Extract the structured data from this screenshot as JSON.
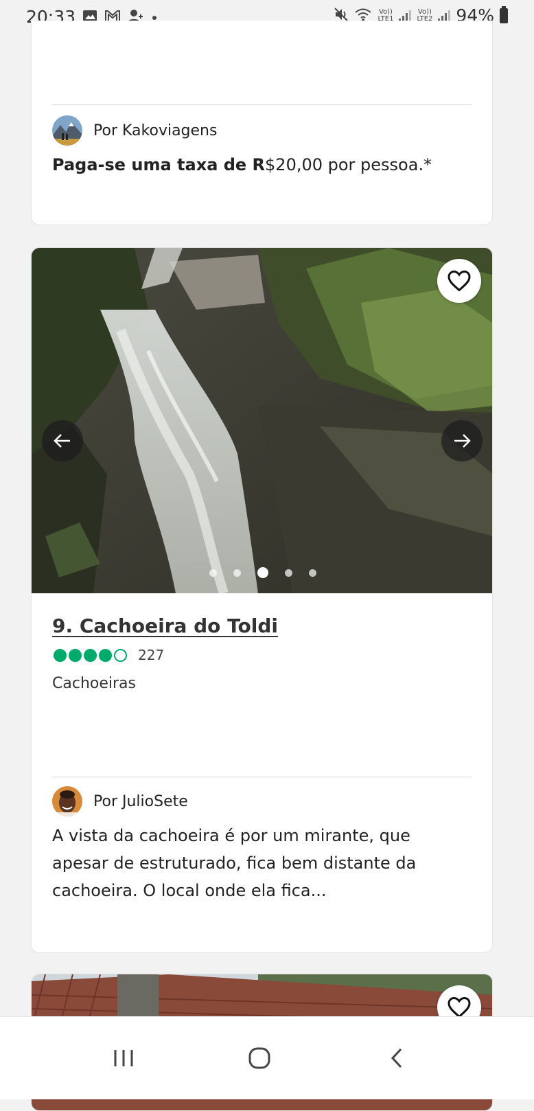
{
  "status_bar": {
    "time": "20:33",
    "battery": "94%",
    "left_icons": [
      "image-icon",
      "gmail-icon",
      "contacts-icon",
      "dot-icon"
    ],
    "right_icons": [
      "mute-icon",
      "wifi-icon",
      "volte-lte1-icon",
      "signal-icon",
      "volte-lte2-icon",
      "signal-icon",
      "battery-icon"
    ],
    "lte1_top": "Vo))",
    "lte1_bottom": "LTE1",
    "lte2_top": "Vo))",
    "lte2_bottom": "LTE2"
  },
  "previous_card": {
    "review": {
      "by_prefix": "Por",
      "author": "Kakoviagens",
      "text_bold": "Paga-se uma taxa de R",
      "text_regular": "$20,00 por pessoa.*"
    }
  },
  "main_card": {
    "title": "9. Cachoeira do Toldi",
    "rating": 4,
    "rating_max": 5,
    "review_count": "227",
    "category": "Cachoeiras",
    "carousel": {
      "total": 5,
      "active_index": 2
    },
    "review": {
      "by_prefix": "Por",
      "author": "JulioSete",
      "text_lines": [
        "A vista da cachoeira é por um mirante, que",
        "apesar de estruturado, fica bem distante da",
        "cachoeira. O local onde ela fica..."
      ]
    }
  },
  "colors": {
    "rating_green": "#00aa6c",
    "card_bg": "#ffffff",
    "page_bg": "#f2f2f2"
  }
}
